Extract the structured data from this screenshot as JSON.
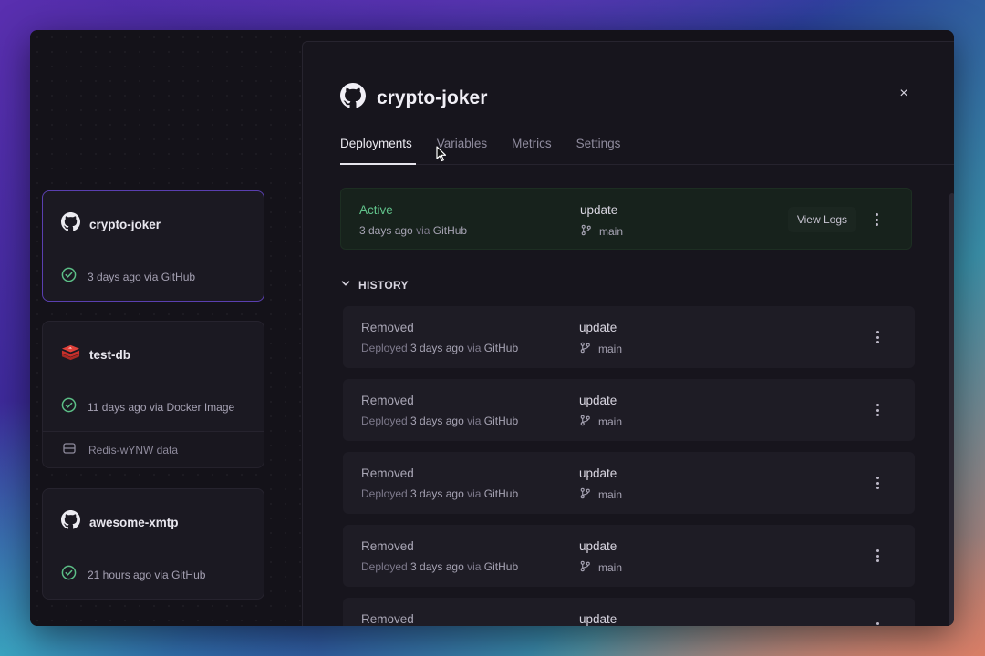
{
  "colors": {
    "accent_selected": "#5a3fb0",
    "active_status": "#61c38b",
    "check": "#5cbf87",
    "redis_red": "#d83a34"
  },
  "sidebar": {
    "services": [
      {
        "name": "crypto-joker",
        "icon": "github-icon",
        "status": "3 days ago via GitHub",
        "selected": true
      },
      {
        "name": "test-db",
        "icon": "redis-icon",
        "status": "11 days ago via Docker Image",
        "volume": "Redis-wYNW data"
      },
      {
        "name": "awesome-xmtp",
        "icon": "github-icon",
        "status": "21 hours ago via GitHub"
      }
    ]
  },
  "panel": {
    "title": "crypto-joker",
    "close_label": "×",
    "tabs": [
      "Deployments",
      "Variables",
      "Metrics",
      "Settings"
    ],
    "active_deployment": {
      "status": "Active",
      "time": "3 days ago",
      "via": "via",
      "source": "GitHub",
      "commit": "update",
      "branch": "main",
      "view_logs": "View Logs"
    },
    "history_label": "HISTORY",
    "history": [
      {
        "status": "Removed",
        "prefix": "Deployed",
        "time": "3 days ago",
        "via": "via",
        "source": "GitHub",
        "commit": "update",
        "branch": "main"
      },
      {
        "status": "Removed",
        "prefix": "Deployed",
        "time": "3 days ago",
        "via": "via",
        "source": "GitHub",
        "commit": "update",
        "branch": "main"
      },
      {
        "status": "Removed",
        "prefix": "Deployed",
        "time": "3 days ago",
        "via": "via",
        "source": "GitHub",
        "commit": "update",
        "branch": "main"
      },
      {
        "status": "Removed",
        "prefix": "Deployed",
        "time": "3 days ago",
        "via": "via",
        "source": "GitHub",
        "commit": "update",
        "branch": "main"
      },
      {
        "status": "Removed",
        "commit": "update"
      }
    ]
  }
}
